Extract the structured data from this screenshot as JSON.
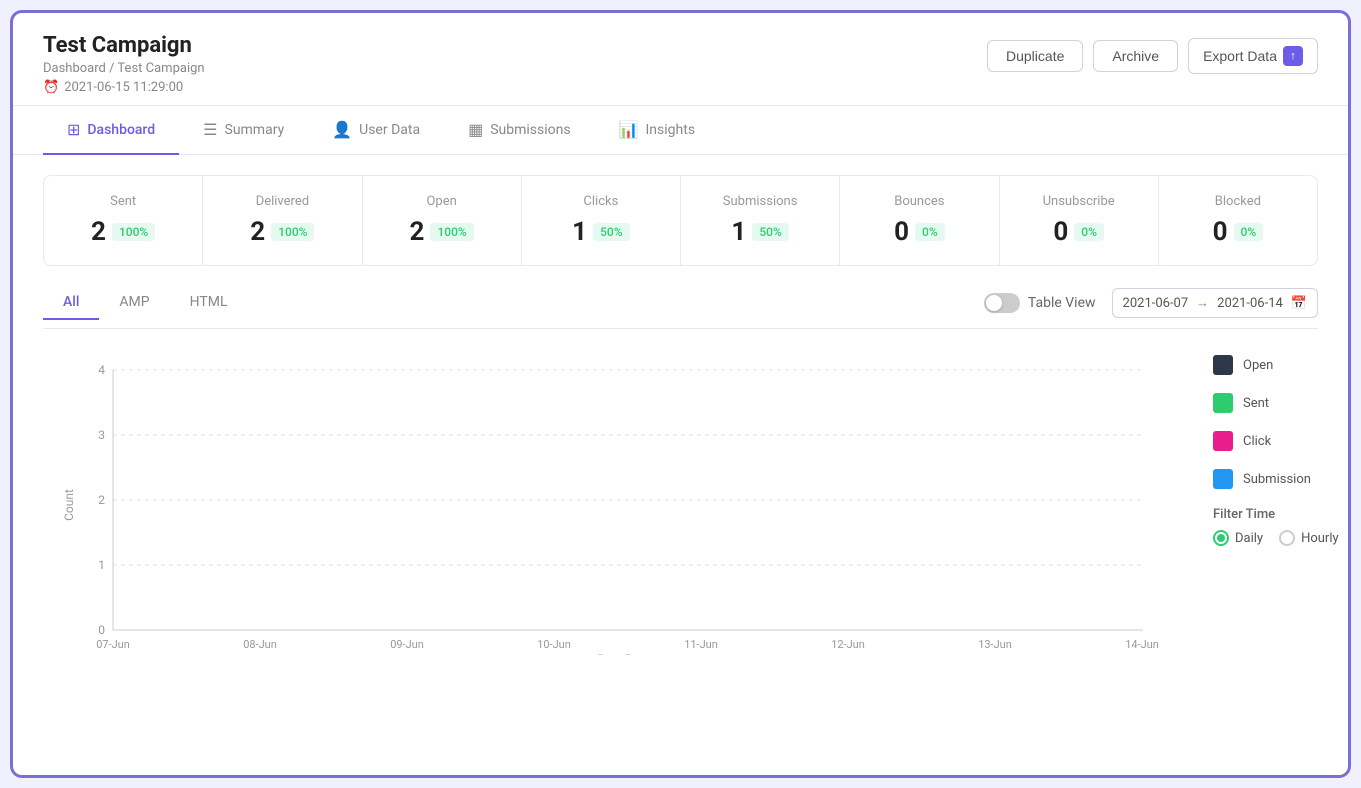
{
  "page": {
    "title": "Test Campaign",
    "breadcrumb": "Dashboard  /  Test Campaign",
    "timestamp": "2021-06-15 11:29:00"
  },
  "header_buttons": {
    "duplicate": "Duplicate",
    "archive": "Archive",
    "export": "Export Data"
  },
  "tabs": [
    {
      "id": "dashboard",
      "label": "Dashboard",
      "icon": "⊞",
      "active": true
    },
    {
      "id": "summary",
      "label": "Summary",
      "icon": "☰",
      "active": false
    },
    {
      "id": "user-data",
      "label": "User Data",
      "icon": "👤",
      "active": false
    },
    {
      "id": "submissions",
      "label": "Submissions",
      "icon": "▦",
      "active": false
    },
    {
      "id": "insights",
      "label": "Insights",
      "icon": "📊",
      "active": false
    }
  ],
  "stats": [
    {
      "label": "Sent",
      "value": "2",
      "badge": "100%",
      "badge_type": "green"
    },
    {
      "label": "Delivered",
      "value": "2",
      "badge": "100%",
      "badge_type": "green"
    },
    {
      "label": "Open",
      "value": "2",
      "badge": "100%",
      "badge_type": "green"
    },
    {
      "label": "Clicks",
      "value": "1",
      "badge": "50%",
      "badge_type": "green"
    },
    {
      "label": "Submissions",
      "value": "1",
      "badge": "50%",
      "badge_type": "green"
    },
    {
      "label": "Bounces",
      "value": "0",
      "badge": "0%",
      "badge_type": "green"
    },
    {
      "label": "Unsubscribe",
      "value": "0",
      "badge": "0%",
      "badge_type": "green"
    },
    {
      "label": "Blocked",
      "value": "0",
      "badge": "0%",
      "badge_type": "green"
    }
  ],
  "chart_tabs": [
    {
      "label": "All",
      "active": true
    },
    {
      "label": "AMP",
      "active": false
    },
    {
      "label": "HTML",
      "active": false
    }
  ],
  "table_view_label": "Table View",
  "date_range": {
    "start": "2021-06-07",
    "end": "2021-06-14"
  },
  "chart": {
    "y_label": "Count",
    "x_label": "Date Range",
    "y_ticks": [
      "0",
      "1",
      "2",
      "3",
      "4"
    ],
    "x_ticks": [
      "07-Jun",
      "08-Jun",
      "09-Jun",
      "10-Jun",
      "11-Jun",
      "12-Jun",
      "13-Jun",
      "14-Jun"
    ]
  },
  "legend": [
    {
      "label": "Open",
      "color": "#2d3748"
    },
    {
      "label": "Sent",
      "color": "#2ecc71"
    },
    {
      "label": "Click",
      "color": "#e91e8c"
    },
    {
      "label": "Submission",
      "color": "#2196f3"
    }
  ],
  "filter_time": {
    "label": "Filter Time",
    "options": [
      {
        "label": "Daily",
        "checked": true
      },
      {
        "label": "Hourly",
        "checked": false
      }
    ]
  }
}
